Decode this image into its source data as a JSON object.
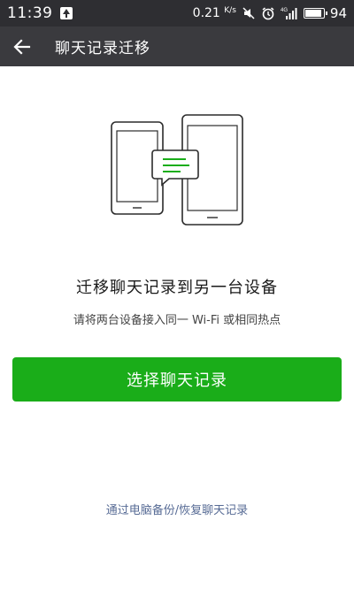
{
  "status_bar": {
    "time": "11:39",
    "net_speed": "0.21",
    "net_speed_unit": "K/s",
    "network_type": "4G",
    "battery": "94"
  },
  "header": {
    "title": "聊天记录迁移",
    "back_icon": "arrow-left"
  },
  "illustration": {
    "accent_color": "#1aad19"
  },
  "main": {
    "title": "迁移聊天记录到另一台设备",
    "subtitle": "请将两台设备接入同一 Wi-Fi 或相同热点",
    "primary_button": "选择聊天记录",
    "bottom_link": "通过电脑备份/恢复聊天记录"
  },
  "colors": {
    "status_bar": "#2e2e32",
    "header": "#3a3a3e",
    "primary": "#1aad19",
    "link": "#576b95"
  }
}
